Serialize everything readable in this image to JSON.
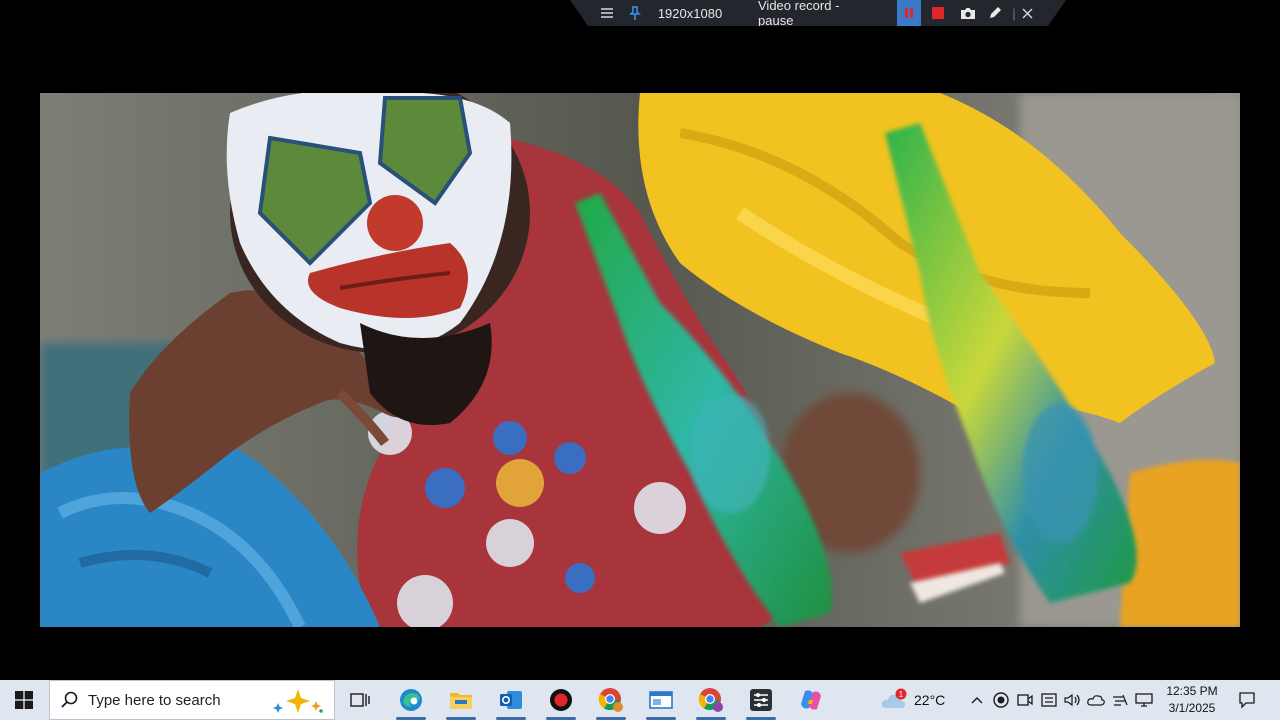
{
  "recorder_toolbar": {
    "menu_icon": "hamburger-menu-icon",
    "pin_icon": "pin-icon",
    "resolution": "1920x1080",
    "status": "Video record - pause",
    "pause_icon": "pause-icon",
    "stop_icon": "stop-icon",
    "screenshot_icon": "camera-icon",
    "draw_icon": "pen-icon",
    "separator": "|",
    "close_icon": "close-icon",
    "colors": {
      "pause_bg": "#3a78c8",
      "stop": "#e0262b",
      "bar_bg": "#23272d"
    }
  },
  "video": {
    "content": "video-frame"
  },
  "taskbar": {
    "start_icon": "windows-start-icon",
    "search": {
      "placeholder": "Type here to search",
      "icon": "search-icon",
      "highlight_icon": "sparkle-icon"
    },
    "apps": [
      {
        "name": "task-view",
        "icon": "task-view-icon"
      },
      {
        "name": "edge",
        "icon": "edge-browser-icon",
        "active": true
      },
      {
        "name": "file-explorer",
        "icon": "folder-icon",
        "active": true
      },
      {
        "name": "outlook",
        "icon": "outlook-icon",
        "active": true
      },
      {
        "name": "recorder",
        "icon": "record-icon",
        "active": true
      },
      {
        "name": "chrome-profile-1",
        "icon": "chrome-icon",
        "active": true
      },
      {
        "name": "window-app",
        "icon": "window-app-icon",
        "active": true
      },
      {
        "name": "chrome-profile-2",
        "icon": "chrome-icon",
        "active": true
      },
      {
        "name": "control-panel",
        "icon": "settings-sliders-icon",
        "active": true
      },
      {
        "name": "copilot",
        "icon": "copilot-icon"
      }
    ],
    "weather": {
      "icon": "cloud-icon",
      "badge": "1",
      "temperature": "22°C"
    },
    "tray": [
      "chevron-up-icon",
      "record-tray-icon",
      "meet-icon",
      "keyboard-icon",
      "speaker-icon",
      "onedrive-icon",
      "network-icon",
      "display-icon"
    ],
    "clock": {
      "time": "12:35 PM",
      "date": "3/1/2025"
    },
    "notification_icon": "notification-icon"
  }
}
